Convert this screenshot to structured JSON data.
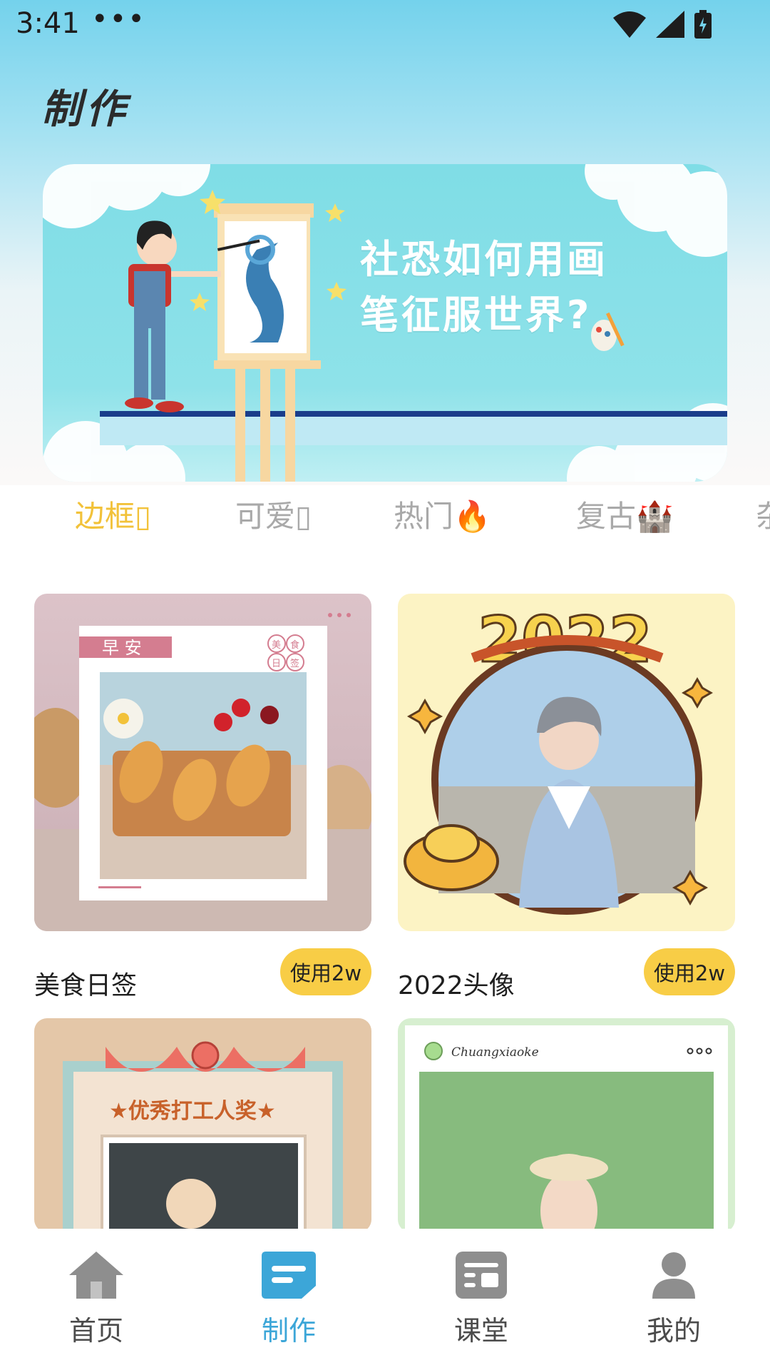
{
  "status_bar": {
    "time": "3:41",
    "overflow": "•••"
  },
  "header": {
    "title": "制作"
  },
  "banner": {
    "line1": "社恐如何用画",
    "line2": "笔征服世界?"
  },
  "tabs": [
    {
      "label": "边框",
      "emoji": "▯",
      "active": true
    },
    {
      "label": "可爱",
      "emoji": "▯",
      "active": false
    },
    {
      "label": "热门",
      "emoji": "🔥",
      "active": false
    },
    {
      "label": "复古",
      "emoji": "🏰",
      "active": false
    },
    {
      "label": "杂",
      "emoji": "",
      "active": false
    }
  ],
  "cards": [
    {
      "name": "美食日签",
      "button": "使用2w",
      "frame_text": "早 安",
      "stamp": [
        "美",
        "食",
        "日",
        "签"
      ]
    },
    {
      "name": "2022头像",
      "button": "使用2w",
      "frame_text": "2022"
    },
    {
      "name": "",
      "button": "",
      "frame_text": "优秀打工人奖"
    },
    {
      "name": "",
      "button": "",
      "frame_text": "Chuangxiaoke"
    }
  ],
  "nav": [
    {
      "label": "首页",
      "icon": "home-icon",
      "active": false
    },
    {
      "label": "制作",
      "icon": "create-icon",
      "active": true
    },
    {
      "label": "课堂",
      "icon": "classroom-icon",
      "active": false
    },
    {
      "label": "我的",
      "icon": "profile-icon",
      "active": false
    }
  ],
  "colors": {
    "accent_yellow": "#f8cd46",
    "active_tab": "#f2c23a",
    "nav_active": "#3ca6d8",
    "sky": "#74d2ec"
  }
}
